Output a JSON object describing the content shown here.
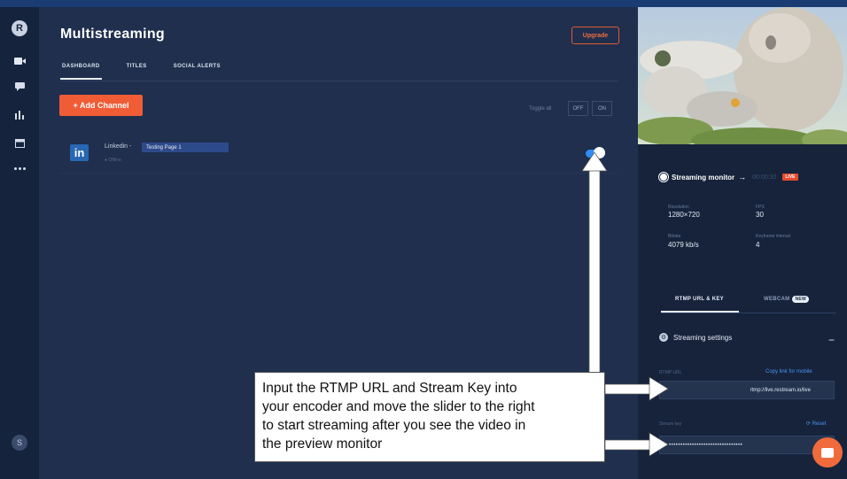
{
  "rail": {
    "icons": [
      "restream-logo-icon",
      "video-icon",
      "chat-icon",
      "analytics-icon",
      "calendar-icon",
      "more-icon"
    ],
    "avatar_initial": "S",
    "logo_glyph": "R"
  },
  "header": {
    "title": "Multistreaming",
    "upgrade_label": "Upgrade",
    "tabs": [
      {
        "label": "DASHBOARD",
        "active": true
      },
      {
        "label": "TITLES",
        "active": false
      },
      {
        "label": "SOCIAL ALERTS",
        "active": false
      }
    ]
  },
  "channels": {
    "add_label": "+ Add Channel",
    "toggle_all_label": "Toggle all",
    "toggle_off": "OFF",
    "toggle_on": "ON",
    "items": [
      {
        "name": "Linkedin -",
        "tag": "Testing Page 1",
        "status": "● Offline",
        "icon": "linkedin-icon",
        "enabled": true
      }
    ]
  },
  "monitor": {
    "title": "Streaming monitor",
    "timer": "00:00:32",
    "live_label": "LIVE",
    "stats": [
      {
        "label": "Resolution",
        "value": "1280×720"
      },
      {
        "label": "FPS",
        "value": "30"
      },
      {
        "label": "Bitrate",
        "value": "4079 kb/s"
      },
      {
        "label": "Keyframe interval",
        "value": "4"
      }
    ],
    "tabs": [
      {
        "label": "RTMP URL & KEY",
        "active": true
      },
      {
        "label": "WEBCAM",
        "active": false,
        "badge": "NEW"
      }
    ]
  },
  "settings": {
    "title": "Streaming settings",
    "collapse_symbol": "−",
    "rtmp_label": "RTMP URL",
    "copy_link_label": "Copy link for mobile",
    "rtmp_value": "rtmp://live.restream.io/live",
    "key_label": "Stream key",
    "reset_label": "Reset",
    "key_value": "••••••••••••••••••••••••••••••••"
  },
  "annotation": {
    "lines": [
      "Input the RTMP URL and Stream Key into",
      "your encoder and move the slider to the right",
      "to start streaming after you see the video in",
      "the preview monitor"
    ]
  },
  "colors": {
    "accent_orange": "#ef5c36",
    "toggle_blue": "#2f8cf0",
    "linkedin_blue": "#2867b2",
    "background": "#1f2f4d"
  }
}
